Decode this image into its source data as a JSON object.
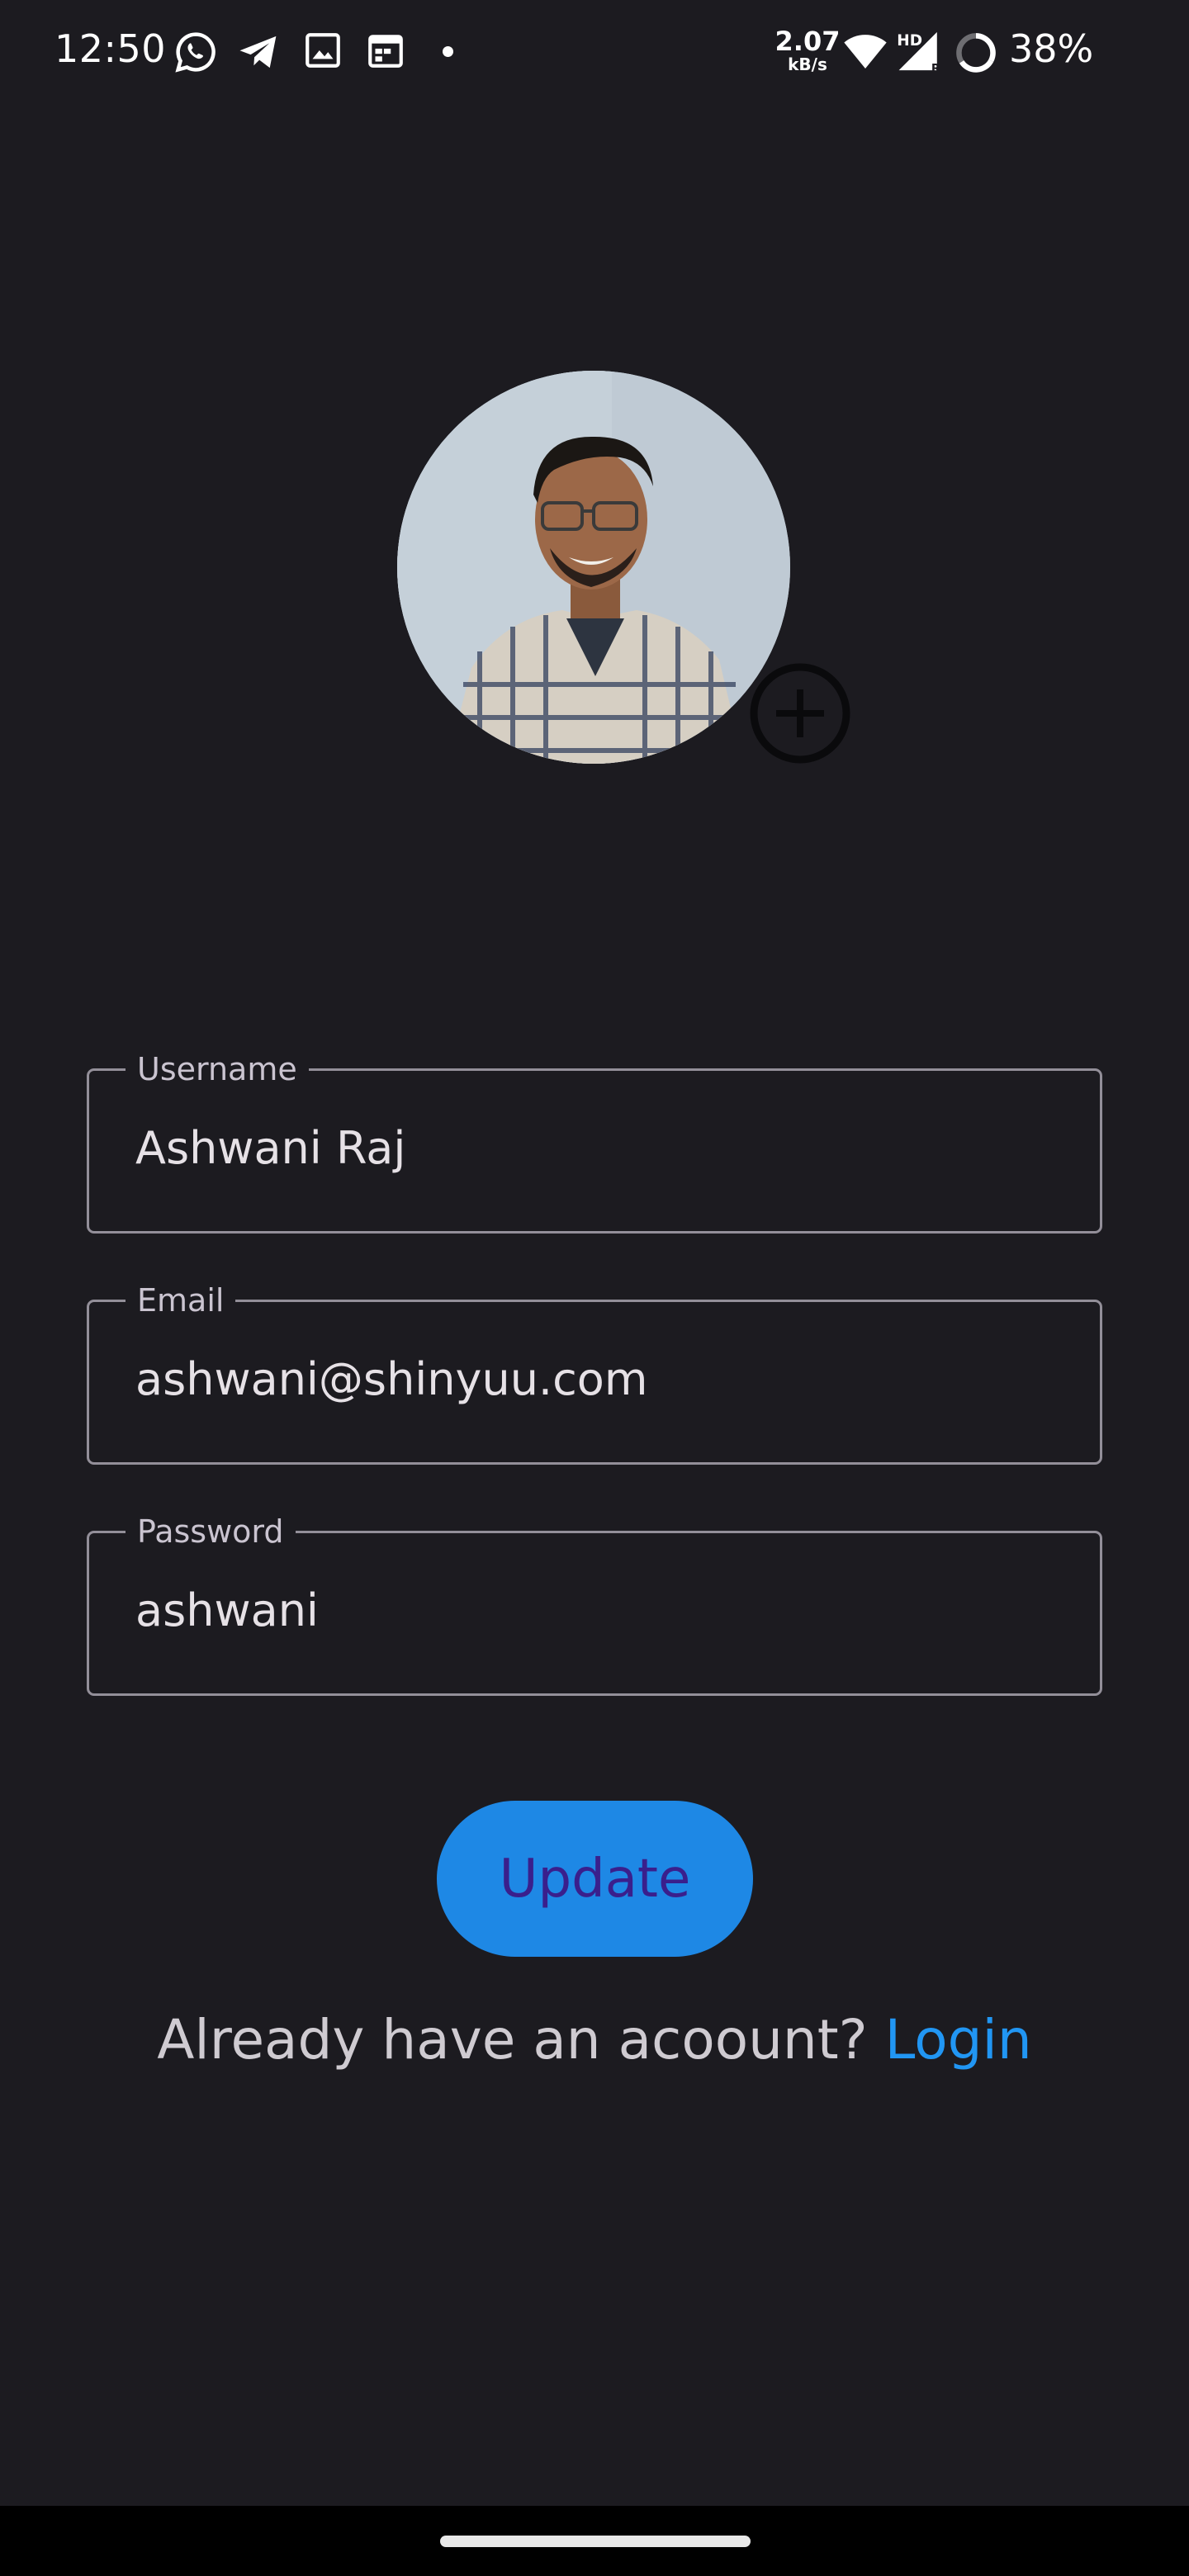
{
  "status_bar": {
    "time": "12:50",
    "net_speed_value": "2.07",
    "net_speed_unit": "kB/s",
    "network_type": "HD",
    "signal_sub": "R",
    "battery_percent": "38%",
    "icons": [
      "whatsapp-icon",
      "telegram-icon",
      "gallery-icon",
      "calendar-icon",
      "notification-dot",
      "wifi-icon",
      "signal-icon",
      "battery-ring-icon"
    ]
  },
  "profile": {
    "avatar_alt": "profile photo",
    "add_photo_icon": "add-circle-icon"
  },
  "form": {
    "username": {
      "label": "Username",
      "value": "Ashwani Raj"
    },
    "email": {
      "label": "Email",
      "value": "ashwani@shinyuu.com"
    },
    "password": {
      "label": "Password",
      "value": "ashwani"
    }
  },
  "actions": {
    "update_label": "Update",
    "login_prompt": "Already have an acoount?",
    "login_link": "Login"
  },
  "colors": {
    "background": "#1c1b20",
    "accent": "#1e88e5",
    "button_text": "#3a1f8c",
    "link": "#2196f3",
    "outline": "#938f99"
  }
}
